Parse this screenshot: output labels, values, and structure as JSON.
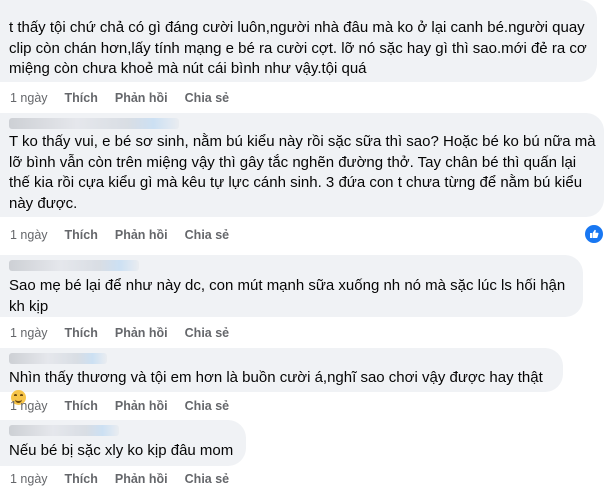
{
  "comments": [
    {
      "text": "t thấy tội chứ chả có gì đáng cười luôn,người nhà đâu mà ko ở lại canh bé.người quay clip còn chán hơn,lấy tính mạng e bé ra cười cợt. lỡ nó sặc hay gì thì sao.mới đẻ ra cơ miệng còn chưa khoẻ mà nút cái bình như vậy.tội quá",
      "time": "1 ngày",
      "like": "Thích",
      "reply": "Phản hồi",
      "share": "Chia sẻ"
    },
    {
      "text": "T ko thấy vui, e bé sơ sinh, nằm bú kiểu này rồi sặc sữa thì sao? Hoặc bé ko bú nữa mà lỡ bình vẫn còn trên miệng vậy thì gây tắc nghẽn đường thở. Tay chân bé thì quấn lại thế kia rồi cựa kiểu gì mà kêu tự lực cánh sinh. 3 đứa con t chưa từng để nằm bú kiểu này được.",
      "time": "1 ngày",
      "like": "Thích",
      "reply": "Phản hồi",
      "share": "Chia sẻ",
      "reaction": "like"
    },
    {
      "text": "Sao mẹ bé lại để như này dc, con mút mạnh sữa xuống nh nó mà sặc lúc ls hối hận kh kịp",
      "time": "1 ngày",
      "like": "Thích",
      "reply": "Phản hồi",
      "share": "Chia sẻ"
    },
    {
      "text": "Nhìn thấy thương và tội em hơn là buồn cười á,nghĩ sao chơi vậy được hay thật",
      "time": "1 ngày",
      "like": "Thích",
      "reply": "Phản hồi",
      "share": "Chia sẻ",
      "emoji": "smiling-face"
    },
    {
      "text": "Nếu bé bị sặc xly ko kịp đâu mom",
      "time": "1 ngày",
      "like": "Thích",
      "reply": "Phản hồi",
      "share": "Chia sẻ"
    }
  ]
}
